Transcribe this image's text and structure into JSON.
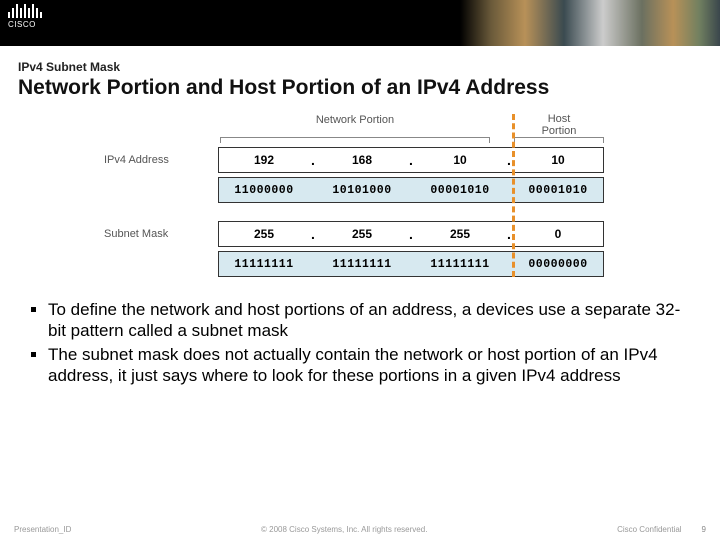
{
  "header": {
    "brand": "CISCO"
  },
  "section_label": "IPv4 Subnet Mask",
  "title": "Network Portion and Host Portion of an IPv4 Address",
  "diagram": {
    "net_label": "Network Portion",
    "host_label": "Host\nPortion",
    "ipv4_label": "IPv4 Address",
    "subnet_label": "Subnet Mask",
    "ip_dec": [
      "192",
      "168",
      "10",
      "10"
    ],
    "ip_bin": [
      "11000000",
      "10101000",
      "00001010",
      "00001010"
    ],
    "mask_dec": [
      "255",
      "255",
      "255",
      "0"
    ],
    "mask_bin": [
      "11111111",
      "11111111",
      "11111111",
      "00000000"
    ],
    "dot": "."
  },
  "bullets": {
    "b1": "To define the network and host portions of an address, a devices use a separate 32-bit pattern called a subnet mask",
    "b2": "The subnet mask does not actually contain the network or host portion of an IPv4 address, it just says where to look for these portions in a given IPv4 address"
  },
  "footer": {
    "pid": "Presentation_ID",
    "copy": "© 2008 Cisco Systems, Inc. All rights reserved.",
    "conf": "Cisco Confidential",
    "page": "9"
  }
}
